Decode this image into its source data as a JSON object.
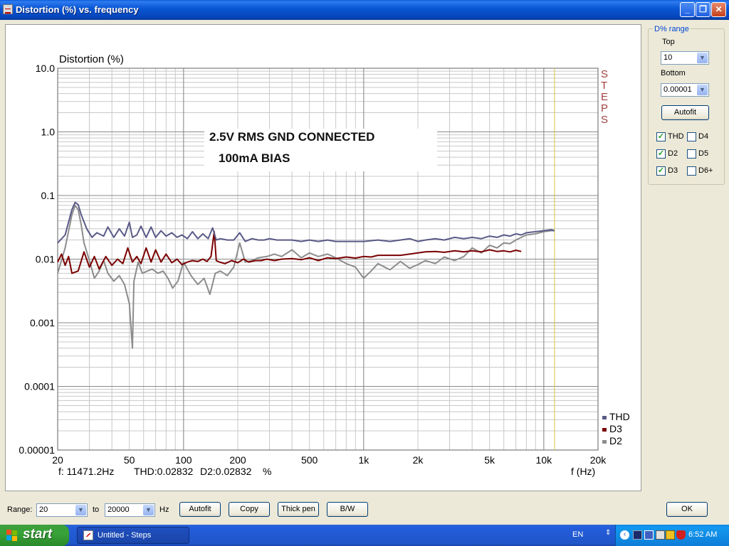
{
  "window": {
    "title": "Distortion (%) vs. frequency",
    "controls": {
      "minimize": "_",
      "maximize": "❐",
      "close": "✕"
    }
  },
  "plot": {
    "readout": {
      "freq": "f:  11471.2Hz",
      "thd": "THD:0.02832",
      "d2": "D2:0.02832",
      "unit": "%"
    },
    "annotation_line1": "2.5V RMS GND CONNECTED",
    "annotation_line2": "100mA BIAS",
    "steps_letters": [
      "S",
      "T",
      "E",
      "P",
      "S"
    ],
    "cursor_freq": 11471.2
  },
  "chart_data": {
    "type": "line",
    "title": "",
    "ylabel": "Distortion (%)",
    "xlabel": "f (Hz)",
    "xscale": "log",
    "yscale": "log",
    "xlim": [
      20,
      20000
    ],
    "ylim": [
      1e-05,
      10
    ],
    "xtick_values": [
      20,
      50,
      100,
      200,
      500,
      1000,
      2000,
      5000,
      10000,
      20000
    ],
    "xtick_labels": [
      "20",
      "50",
      "100",
      "200",
      "500",
      "1k",
      "2k",
      "5k",
      "10k",
      "20k"
    ],
    "ytick_values": [
      10,
      1,
      0.1,
      0.01,
      0.001,
      0.0001,
      1e-05
    ],
    "ytick_labels": [
      "10.0",
      "1.0",
      "0.1",
      "0.01",
      "0.001",
      "0.0001",
      "0.00001"
    ],
    "grid": true,
    "legend": "bottom-right",
    "series": [
      {
        "name": "THD",
        "color": "#5a5a88",
        "x": [
          20,
          22,
          24,
          25,
          26,
          27,
          29,
          31,
          33,
          36,
          38,
          41,
          44,
          47,
          50,
          52,
          55,
          58,
          62,
          66,
          70,
          75,
          80,
          86,
          92,
          98,
          105,
          112,
          120,
          128,
          137,
          145,
          152,
          160,
          175,
          190,
          205,
          220,
          240,
          260,
          280,
          300,
          330,
          360,
          400,
          450,
          500,
          560,
          630,
          700,
          800,
          900,
          1000,
          1200,
          1400,
          1600,
          1800,
          2000,
          2200,
          2500,
          2800,
          3200,
          3600,
          4000,
          4500,
          5000,
          5500,
          6000,
          6500,
          7000,
          7500,
          8000,
          9000,
          10000,
          11000,
          11471
        ],
        "y": [
          0.018,
          0.024,
          0.06,
          0.078,
          0.072,
          0.05,
          0.03,
          0.022,
          0.026,
          0.023,
          0.032,
          0.022,
          0.03,
          0.023,
          0.038,
          0.022,
          0.024,
          0.033,
          0.022,
          0.032,
          0.022,
          0.028,
          0.023,
          0.026,
          0.022,
          0.024,
          0.021,
          0.027,
          0.021,
          0.025,
          0.021,
          0.031,
          0.02,
          0.021,
          0.02,
          0.02,
          0.026,
          0.019,
          0.021,
          0.02,
          0.02,
          0.021,
          0.02,
          0.02,
          0.02,
          0.019,
          0.02,
          0.019,
          0.02,
          0.019,
          0.019,
          0.019,
          0.019,
          0.02,
          0.019,
          0.02,
          0.021,
          0.019,
          0.02,
          0.021,
          0.02,
          0.022,
          0.021,
          0.022,
          0.021,
          0.023,
          0.022,
          0.024,
          0.023,
          0.025,
          0.024,
          0.026,
          0.027,
          0.028,
          0.029,
          0.028
        ]
      },
      {
        "name": "D3",
        "color": "#7a0000",
        "x": [
          20,
          21,
          22,
          23,
          24,
          26,
          28,
          30,
          32,
          34,
          37,
          40,
          43,
          46,
          49,
          52,
          55,
          58,
          62,
          66,
          70,
          75,
          80,
          86,
          92,
          98,
          105,
          112,
          120,
          128,
          135,
          142,
          148,
          152,
          158,
          170,
          185,
          200,
          215,
          230,
          250,
          270,
          290,
          320,
          350,
          400,
          450,
          500,
          560,
          630,
          700,
          800,
          900,
          1000,
          1100,
          1200,
          1400,
          1600,
          1800,
          2000,
          2200,
          2500,
          2800,
          3200,
          3600,
          4000,
          4500,
          5000,
          5500,
          6000,
          6500,
          7000,
          7500
        ],
        "y": [
          0.009,
          0.012,
          0.008,
          0.011,
          0.006,
          0.0065,
          0.013,
          0.0075,
          0.011,
          0.007,
          0.011,
          0.008,
          0.01,
          0.0085,
          0.015,
          0.009,
          0.011,
          0.0085,
          0.015,
          0.009,
          0.014,
          0.009,
          0.012,
          0.0088,
          0.01,
          0.0082,
          0.009,
          0.0095,
          0.0092,
          0.01,
          0.0092,
          0.011,
          0.027,
          0.0095,
          0.009,
          0.0085,
          0.0095,
          0.0088,
          0.01,
          0.009,
          0.0095,
          0.0095,
          0.01,
          0.0095,
          0.01,
          0.0102,
          0.0098,
          0.0105,
          0.0095,
          0.0105,
          0.0102,
          0.0108,
          0.0104,
          0.011,
          0.0108,
          0.0115,
          0.0115,
          0.0115,
          0.012,
          0.0125,
          0.013,
          0.0132,
          0.0128,
          0.0135,
          0.013,
          0.0135,
          0.013,
          0.014,
          0.0132,
          0.0135,
          0.013,
          0.0138,
          0.0132
        ]
      },
      {
        "name": "D2",
        "color": "#8c8c8c",
        "x": [
          20,
          22,
          24,
          25,
          26,
          27,
          28,
          30,
          32,
          34,
          36,
          38,
          41,
          44,
          47,
          50,
          52,
          53,
          56,
          59,
          63,
          67,
          72,
          77,
          82,
          87,
          93,
          100,
          110,
          120,
          130,
          140,
          150,
          160,
          175,
          190,
          205,
          220,
          240,
          260,
          290,
          320,
          350,
          400,
          450,
          500,
          560,
          630,
          700,
          800,
          900,
          1000,
          1100,
          1200,
          1400,
          1600,
          1800,
          2000,
          2200,
          2500,
          2800,
          3200,
          3600,
          4000,
          4500,
          5000,
          5500,
          6000,
          6500,
          7000,
          7500,
          8000,
          9000,
          10000,
          11000,
          11471
        ],
        "y": [
          0.006,
          0.015,
          0.05,
          0.07,
          0.06,
          0.035,
          0.018,
          0.0095,
          0.005,
          0.0065,
          0.0095,
          0.006,
          0.0045,
          0.0055,
          0.004,
          0.002,
          0.0004,
          0.0045,
          0.009,
          0.006,
          0.0065,
          0.007,
          0.006,
          0.0065,
          0.005,
          0.0035,
          0.0045,
          0.009,
          0.0055,
          0.004,
          0.005,
          0.0028,
          0.006,
          0.0065,
          0.0055,
          0.0075,
          0.018,
          0.009,
          0.0095,
          0.0105,
          0.011,
          0.012,
          0.011,
          0.014,
          0.0105,
          0.0125,
          0.011,
          0.012,
          0.0105,
          0.0085,
          0.0075,
          0.005,
          0.0065,
          0.0085,
          0.0068,
          0.0092,
          0.0072,
          0.0082,
          0.0095,
          0.0085,
          0.0108,
          0.0095,
          0.011,
          0.015,
          0.0125,
          0.0165,
          0.015,
          0.018,
          0.0175,
          0.02,
          0.022,
          0.024,
          0.025,
          0.027,
          0.028,
          0.028
        ]
      }
    ]
  },
  "side_panel": {
    "group_label": "D% range",
    "top_label": "Top",
    "top_value": "10",
    "bottom_label": "Bottom",
    "bottom_value": "0.00001",
    "autofit_label": "Autofit",
    "checkboxes": [
      {
        "label": "THD",
        "checked": true
      },
      {
        "label": "D4",
        "checked": false
      },
      {
        "label": "D2",
        "checked": true
      },
      {
        "label": "D5",
        "checked": false
      },
      {
        "label": "D3",
        "checked": true
      },
      {
        "label": "D6+",
        "checked": false
      }
    ]
  },
  "toolbar": {
    "range_label": "Range:",
    "range_from": "20",
    "to_label": "to",
    "range_to": "20000",
    "hz_label": "Hz",
    "autofit_label": "Autofit",
    "copy_label": "Copy",
    "thick_pen_label": "Thick pen",
    "bw_label": "B/W",
    "ok_label": "OK"
  },
  "taskbar": {
    "start_label": "start",
    "task_label": "Untitled - Steps",
    "language": "EN",
    "clock": "6:52 AM"
  },
  "colors": {
    "titlebar": "#0a58d6",
    "grid": "#c8c8c8",
    "grid_major": "#8a8a8a",
    "cursor": "#d8c840",
    "steps_text": "#a04040"
  }
}
